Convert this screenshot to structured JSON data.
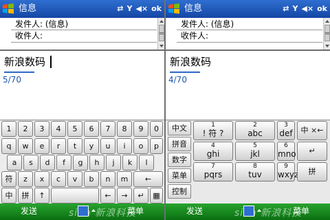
{
  "screens": [
    {
      "id": "left",
      "title": "信息",
      "status": {
        "sync": "⇄",
        "signal": "Y",
        "volume": "◀×",
        "ok": "ok"
      },
      "from_label": "发件人: (信息)",
      "to_label": "收件人:",
      "body_text": "新浪数码",
      "char_counter": "5/70",
      "softkeys": {
        "left": "发送",
        "right": "菜单"
      }
    },
    {
      "id": "right",
      "title": "信息",
      "status": {
        "sync": "⇄",
        "signal": "Y",
        "volume": "◀×",
        "ok": "ok"
      },
      "from_label": "发件人: (信息)",
      "to_label": "收件人:",
      "body_text": "新浪数码",
      "char_counter": "4/70",
      "softkeys": {
        "left": "发送",
        "right": "菜单"
      }
    }
  ],
  "watermark": "sina 新浪科技",
  "qwerty": {
    "row1": [
      "1",
      "2",
      "3",
      "4",
      "5",
      "6",
      "7",
      "8",
      "9",
      "0"
    ],
    "row2": [
      "q",
      "w",
      "e",
      "r",
      "t",
      "y",
      "u",
      "i",
      "o",
      "p"
    ],
    "row3": [
      "a",
      "s",
      "d",
      "f",
      "g",
      "h",
      "j",
      "k",
      "l",
      "←"
    ],
    "row4": [
      "符",
      "z",
      "x",
      "c",
      "v",
      "b",
      "n",
      "m",
      "←"
    ],
    "row5": [
      "中",
      "拼",
      "↑",
      "",
      "←",
      "→",
      "↵",
      "▦"
    ]
  },
  "t9": {
    "side_buttons": [
      "中文",
      "拼音",
      "数字",
      "菜单",
      "控制"
    ],
    "keys": [
      {
        "digit": "1",
        "letters": "! 符 ?"
      },
      {
        "digit": "2",
        "letters": "abc"
      },
      {
        "digit": "3",
        "letters": "def"
      },
      {
        "digit": "4",
        "letters": "ghi"
      },
      {
        "digit": "5",
        "letters": "jkl"
      },
      {
        "digit": "6",
        "letters": "mno"
      },
      {
        "digit": "7",
        "letters": "pqrs"
      },
      {
        "digit": "8",
        "letters": "tuv"
      },
      {
        "digit": "9",
        "letters": "wxyz"
      }
    ],
    "action_keys": [
      "中 ×←",
      "↵",
      "拼"
    ]
  },
  "colors": {
    "titlebar": "#1f56b8",
    "softbar": "#169a1d",
    "accent": "#2d67c7"
  },
  "icons": [
    "windows-logo-icon",
    "sync-icon",
    "signal-icon",
    "volume-icon",
    "sip-keyboard-icon"
  ]
}
